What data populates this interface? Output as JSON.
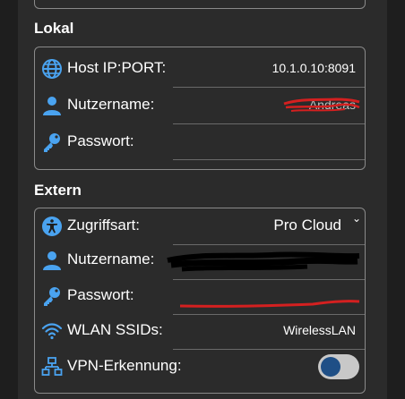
{
  "sections": {
    "local": {
      "title": "Lokal",
      "host_label": "Host IP:PORT:",
      "host_value": "10.1.0.10:8091",
      "user_label": "Nutzername:",
      "user_value": "Andreas",
      "pass_label": "Passwort:"
    },
    "extern": {
      "title": "Extern",
      "access_label": "Zugriffsart:",
      "access_value": "Pro Cloud",
      "user_label": "Nutzername:",
      "pass_label": "Passwort:",
      "wlan_label": "WLAN SSIDs:",
      "wlan_value": "WirelessLAN",
      "vpn_label": "VPN-Erkennung:",
      "vpn_enabled": true
    }
  },
  "colors": {
    "icon_blue": "#4aa3f0",
    "redaction_red": "#d42020",
    "redaction_black": "#000000",
    "toggle_knob": "#1f4f86"
  },
  "icons": {
    "host": "globe-icon",
    "user": "person-icon",
    "password": "key-icon",
    "access": "accessibility-icon",
    "wlan": "wifi-icon",
    "vpn": "network-icon"
  }
}
